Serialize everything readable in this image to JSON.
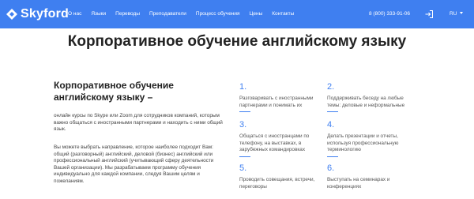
{
  "brand": {
    "name": "Skyford"
  },
  "nav": {
    "links": [
      "О нас",
      "Языки",
      "Переводы",
      "Преподаватели",
      "Процесс обучения",
      "Цены",
      "Контакты"
    ],
    "phone": "8 (800) 333-91-06",
    "lang": "RU"
  },
  "colors": {
    "primary": "#3f7ff0"
  },
  "icons": {
    "login": "login-icon",
    "logo": "logo-mark-icon"
  },
  "hero": {
    "title": "Корпоративное обучение английскому языку"
  },
  "intro": {
    "title": "Корпоративное обучение английскому языку –",
    "p1": "онлайн курсы по Skype или Zoom для сотрудников компаний, которым важно общаться с иностранными партнерами и находить с ними общий язык.",
    "p2": "Вы можете выбрать направление, которое наиболее подходит Вам: общий (разговорный) английский, деловой (бизнес) английский или профессиональный английский (учитывающий сферу деятельности Вашей организации). Мы разрабатываем программу обучения индивидуально для каждой компании, следуя Вашим целям и пожеланиям."
  },
  "features": [
    {
      "num": "1.",
      "text": "Разговаривать с иностранными партнерами и понимать их"
    },
    {
      "num": "2.",
      "text": "Поддерживать беседу на любые темы: деловые и неформальные"
    },
    {
      "num": "3.",
      "text": "Общаться с иностранцами по телефону, на выставках, в зарубежных командировках"
    },
    {
      "num": "4.",
      "text": "Делать презентации и отчеты, используя профессиональную терминологию"
    },
    {
      "num": "5.",
      "text": "Проводить совещания, встречи, переговоры"
    },
    {
      "num": "6.",
      "text": "Выступать на семинарах и конференциях"
    }
  ]
}
